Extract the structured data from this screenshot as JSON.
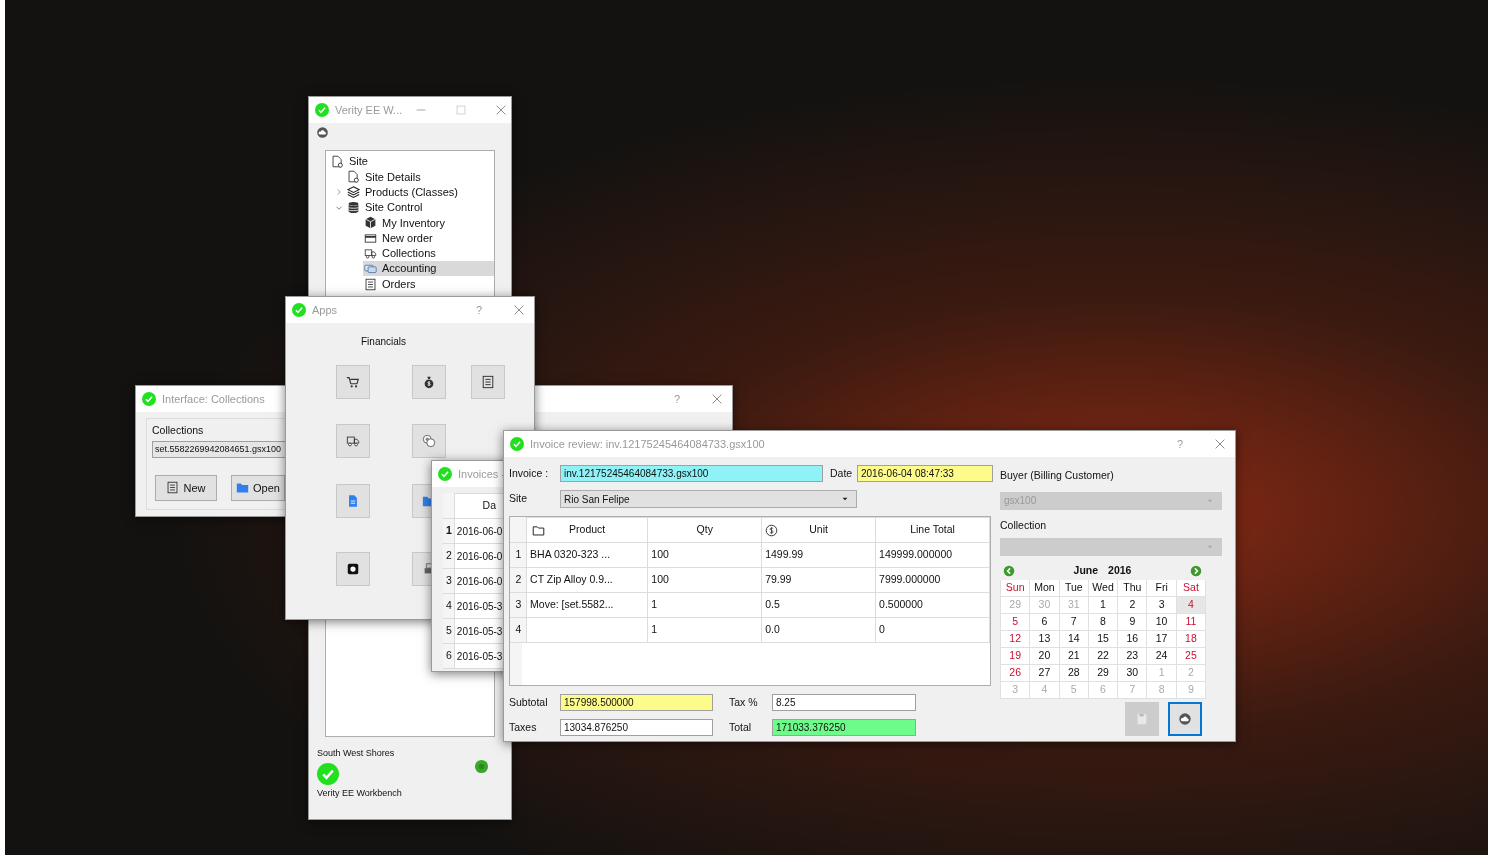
{
  "main_window": {
    "title": "Verity EE W...",
    "tree": [
      {
        "label": "Site",
        "selected": false,
        "children": [
          {
            "label": "Site Details",
            "selected": false
          },
          {
            "label": "Products (Classes)",
            "selected": false,
            "expanded": false
          },
          {
            "label": "Site Control",
            "selected": false,
            "expanded": true,
            "children": [
              {
                "label": "My Inventory",
                "selected": false
              },
              {
                "label": "New order",
                "selected": false
              },
              {
                "label": "Collections",
                "selected": false
              },
              {
                "label": "Accounting",
                "selected": true
              },
              {
                "label": "Orders",
                "selected": false
              }
            ]
          }
        ]
      }
    ],
    "site_name": "South West Shores",
    "app_name": "Verity EE Workbench"
  },
  "collections_window": {
    "title": "Interface: Collections",
    "group_label": "Collections",
    "field_value": "set.5582269942084651.gsx100",
    "buttons": [
      {
        "label": "New"
      },
      {
        "label": "Open"
      }
    ]
  },
  "hidden_window": {
    "help": "?"
  },
  "apps_window": {
    "title": "Apps",
    "help": "?",
    "section": "Financials"
  },
  "invoices_window": {
    "title": "Invoices -",
    "column_header": "Da",
    "rows": [
      {
        "number": "1",
        "date": "2016-06-0",
        "current": true
      },
      {
        "number": "2",
        "date": "2016-06-0",
        "current": false
      },
      {
        "number": "3",
        "date": "2016-06-0",
        "current": false
      },
      {
        "number": "4",
        "date": "2016-05-3",
        "current": false
      },
      {
        "number": "5",
        "date": "2016-05-3",
        "current": false
      },
      {
        "number": "6",
        "date": "2016-05-3",
        "current": false
      }
    ]
  },
  "invoice_window": {
    "title": "Invoice review: inv.12175245464084733.gsx100",
    "help": "?",
    "invoice_label": "Invoice :",
    "invoice_value": "inv.12175245464084733.gsx100",
    "date_label": "Date",
    "date_value": "2016-06-04 08:47:33",
    "site_label": "Site",
    "site_value": "Rio San Felipe",
    "columns": [
      "Product",
      "Qty",
      "Unit",
      "Line Total"
    ],
    "rows": [
      {
        "number": "1",
        "cells": [
          "BHA 0320-323 ...",
          "100",
          "1499.99",
          "149999.000000"
        ]
      },
      {
        "number": "2",
        "cells": [
          "CT Zip Alloy 0.9...",
          "100",
          "79.99",
          "7999.000000"
        ]
      },
      {
        "number": "3",
        "cells": [
          "Move: [set.5582...",
          "1",
          "0.5",
          "0.500000"
        ]
      },
      {
        "number": "4",
        "cells": [
          "",
          "1",
          "0.0",
          "0"
        ]
      }
    ],
    "subtotal_label": "Subtotal",
    "subtotal": "157998.500000",
    "tax_label": "Tax %",
    "tax": "8.25",
    "taxes_label": "Taxes",
    "taxes": "13034.876250",
    "total_label": "Total",
    "total": "171033.376250",
    "buyer_label": "Buyer (Billing Customer)",
    "buyer": {
      "value": "gsx100",
      "disabled": true
    },
    "collection_label": "Collection",
    "collection": {
      "disabled": true
    },
    "calendar": {
      "month": "June",
      "year": "2016",
      "weekdays": [
        "Sun",
        "Mon",
        "Tue",
        "Wed",
        "Thu",
        "Fri",
        "Sat"
      ],
      "weeks": [
        [
          {
            "day": "29",
            "other_month": true,
            "selected": false
          },
          {
            "day": "30",
            "other_month": true,
            "selected": false
          },
          {
            "day": "31",
            "other_month": true,
            "selected": false
          },
          {
            "day": "1",
            "other_month": false,
            "selected": false
          },
          {
            "day": "2",
            "other_month": false,
            "selected": false
          },
          {
            "day": "3",
            "other_month": false,
            "selected": false
          },
          {
            "day": "4",
            "other_month": false,
            "selected": true
          }
        ],
        [
          {
            "day": "5",
            "other_month": false,
            "selected": false
          },
          {
            "day": "6",
            "other_month": false,
            "selected": false
          },
          {
            "day": "7",
            "other_month": false,
            "selected": false
          },
          {
            "day": "8",
            "other_month": false,
            "selected": false
          },
          {
            "day": "9",
            "other_month": false,
            "selected": false
          },
          {
            "day": "10",
            "other_month": false,
            "selected": false
          },
          {
            "day": "11",
            "other_month": false,
            "selected": false
          }
        ],
        [
          {
            "day": "12",
            "other_month": false,
            "selected": false
          },
          {
            "day": "13",
            "other_month": false,
            "selected": false
          },
          {
            "day": "14",
            "other_month": false,
            "selected": false
          },
          {
            "day": "15",
            "other_month": false,
            "selected": false
          },
          {
            "day": "16",
            "other_month": false,
            "selected": false
          },
          {
            "day": "17",
            "other_month": false,
            "selected": false
          },
          {
            "day": "18",
            "other_month": false,
            "selected": false
          }
        ],
        [
          {
            "day": "19",
            "other_month": false,
            "selected": false
          },
          {
            "day": "20",
            "other_month": false,
            "selected": false
          },
          {
            "day": "21",
            "other_month": false,
            "selected": false
          },
          {
            "day": "22",
            "other_month": false,
            "selected": false
          },
          {
            "day": "23",
            "other_month": false,
            "selected": false
          },
          {
            "day": "24",
            "other_month": false,
            "selected": false
          },
          {
            "day": "25",
            "other_month": false,
            "selected": false
          }
        ],
        [
          {
            "day": "26",
            "other_month": false,
            "selected": false
          },
          {
            "day": "27",
            "other_month": false,
            "selected": false
          },
          {
            "day": "28",
            "other_month": false,
            "selected": false
          },
          {
            "day": "29",
            "other_month": false,
            "selected": false
          },
          {
            "day": "30",
            "other_month": false,
            "selected": false
          },
          {
            "day": "1",
            "other_month": true,
            "selected": false
          },
          {
            "day": "2",
            "other_month": true,
            "selected": false
          }
        ],
        [
          {
            "day": "3",
            "other_month": true,
            "selected": false
          },
          {
            "day": "4",
            "other_month": true,
            "selected": false
          },
          {
            "day": "5",
            "other_month": true,
            "selected": false
          },
          {
            "day": "6",
            "other_month": true,
            "selected": false
          },
          {
            "day": "7",
            "other_month": true,
            "selected": false
          },
          {
            "day": "8",
            "other_month": true,
            "selected": false
          },
          {
            "day": "9",
            "other_month": true,
            "selected": false
          }
        ]
      ]
    },
    "buttons": [
      {
        "kind": "save",
        "disabled": true,
        "focused": false
      },
      {
        "kind": "cloud",
        "disabled": false,
        "focused": true
      }
    ]
  }
}
